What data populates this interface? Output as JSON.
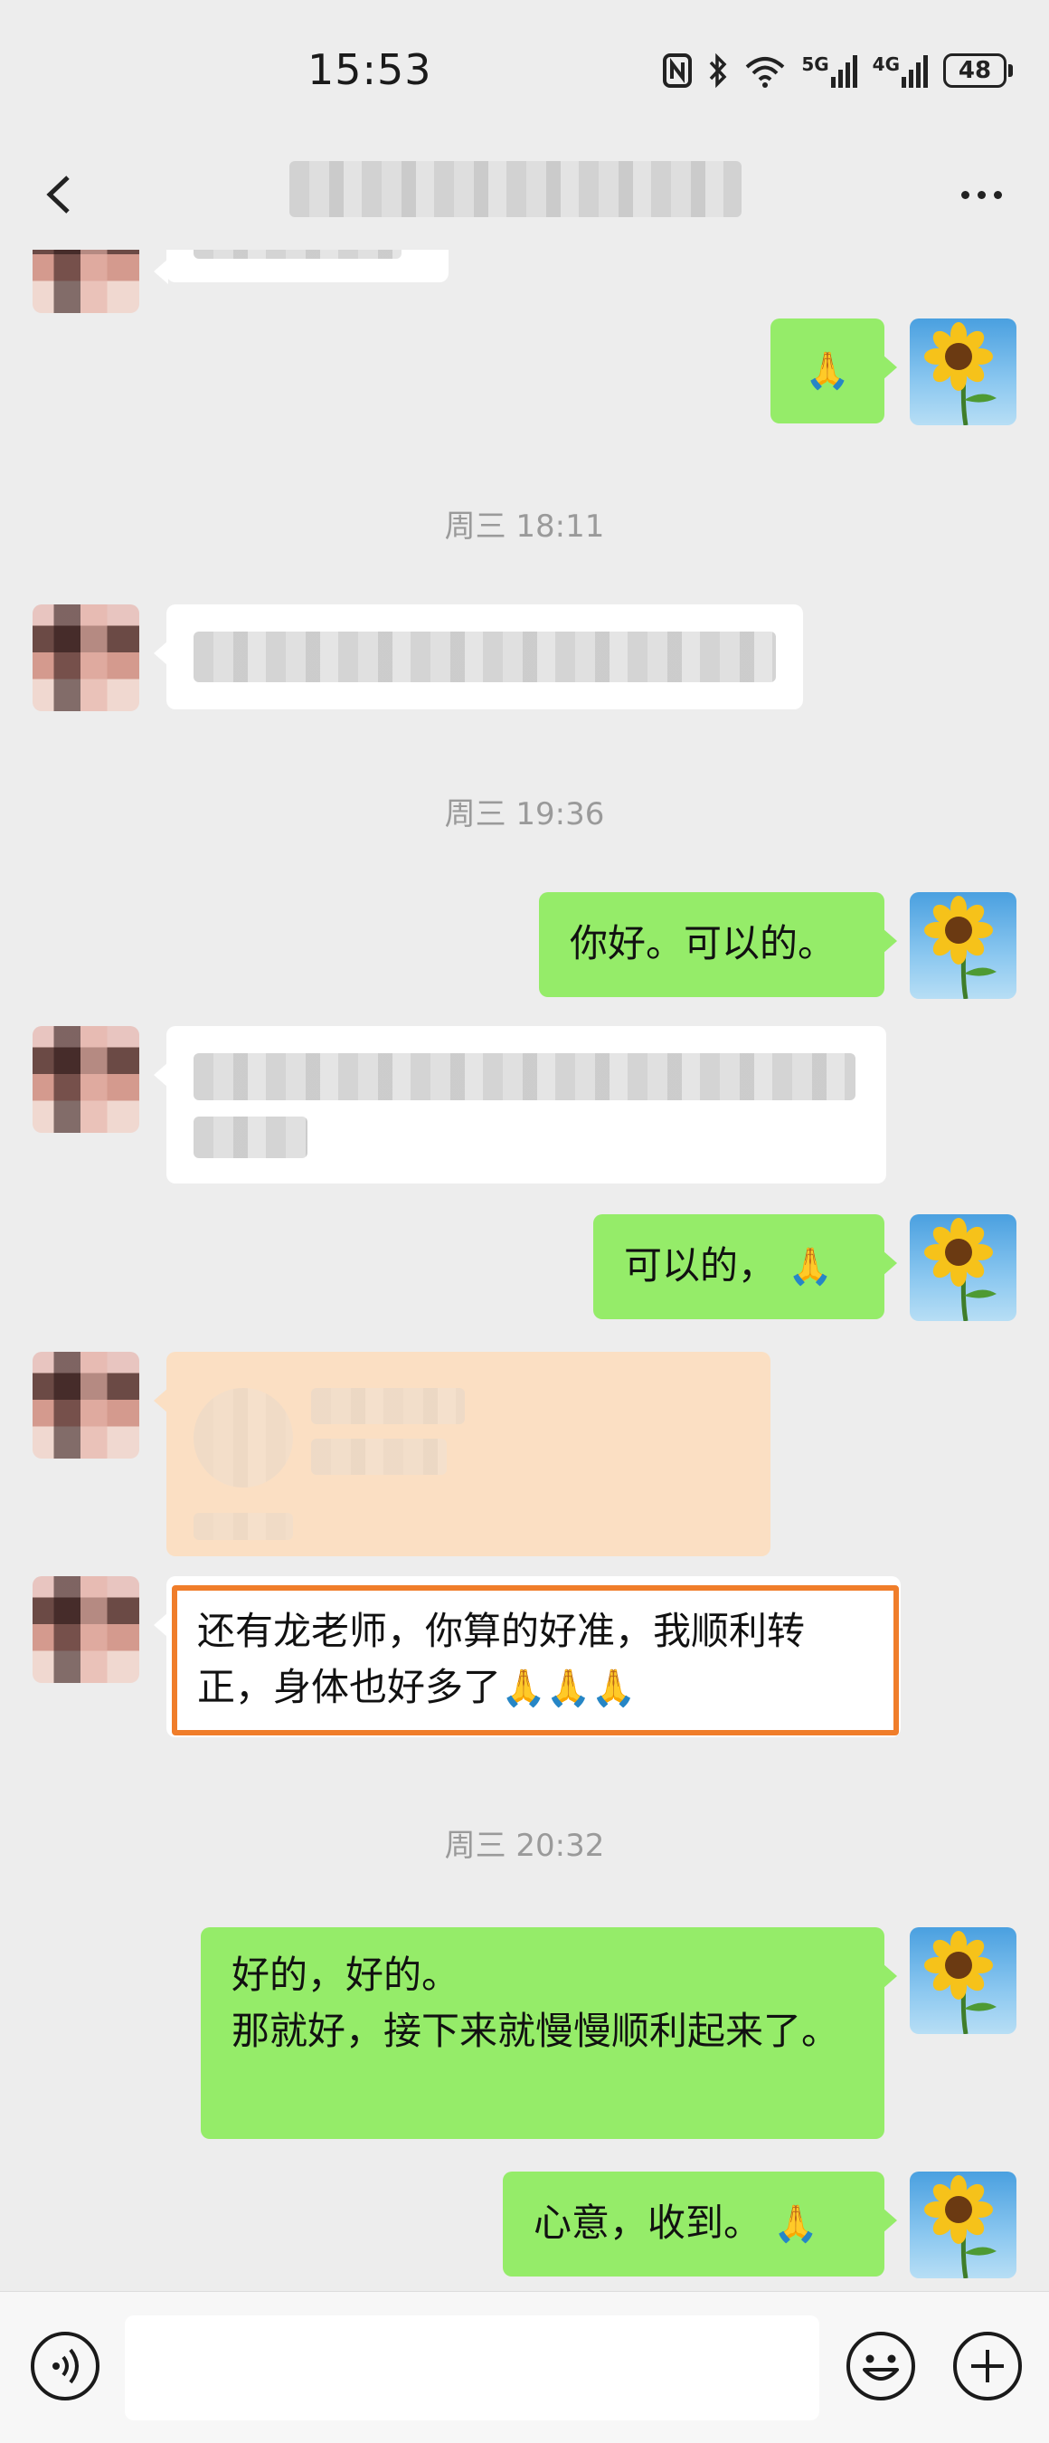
{
  "status_bar": {
    "time": "15:53",
    "network_5g": "5G",
    "network_4g": "4G",
    "battery": "48"
  },
  "nav": {
    "back_icon": "chevron-left-icon",
    "more_icon": "more-dots-icon"
  },
  "timestamps": {
    "t1": "周三 18:11",
    "t2": "周三 19:36",
    "t3": "周三 20:32"
  },
  "messages": {
    "m1_me": "🙏",
    "m2_me": "你好。可以的。",
    "m3_me": "可以的，",
    "m4_them": "还有龙老师，你算的好准，我顺利转正，身体也好多了",
    "m4_emoji": "🙏🙏🙏",
    "m5_me_line1": "好的，好的。",
    "m5_me_line2": "那就好，接下来就慢慢顺利起来了。",
    "m6_me": "心意，收到。"
  },
  "input_bar": {
    "placeholder": "",
    "voice_icon": "voice-icon",
    "emoji_icon": "emoji-icon",
    "plus_icon": "plus-icon"
  },
  "colors": {
    "background": "#ededed",
    "my_bubble": "#95ec69",
    "their_bubble": "#ffffff",
    "highlight": "#f07d2a",
    "timestamp": "#9a9a9a"
  }
}
